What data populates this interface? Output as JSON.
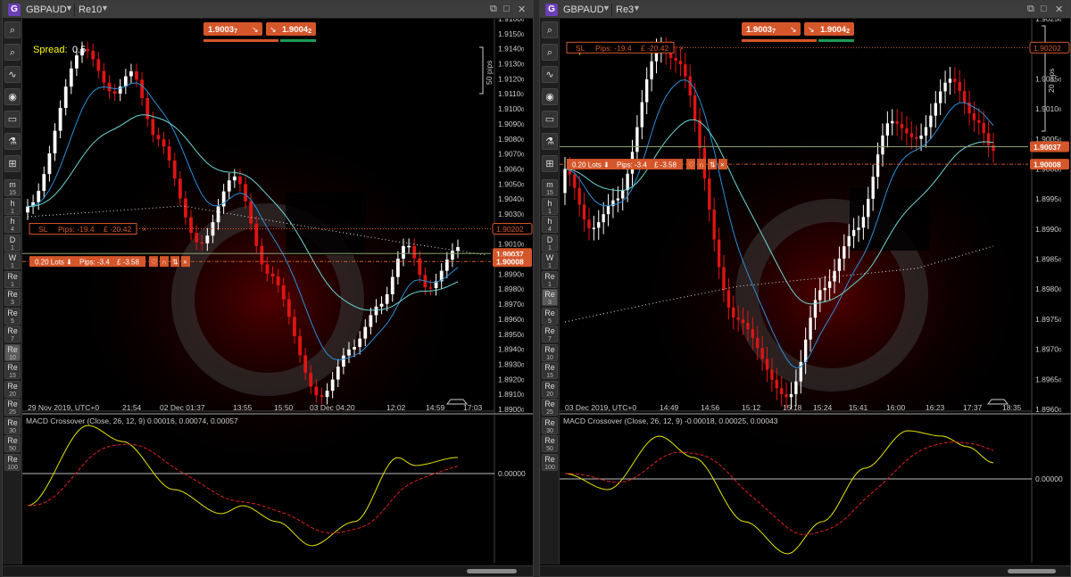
{
  "colors": {
    "bull": "#ffffff",
    "bear": "#e01414",
    "ma_fast": "#2a8fd6",
    "ma_slow": "#6fd6d6",
    "macd": "#e6e600",
    "signal": "#e02020",
    "orange": "#d4562a",
    "green": "#1f9a55"
  },
  "panels": [
    {
      "symbol": "GBPAUD",
      "timeframe": "Re10",
      "spread_label": "Spread:",
      "spread_value": "0.5",
      "bid_price": "1.9003",
      "bid_sup": "7",
      "ask_price": "1.9004",
      "ask_sup": "2",
      "scale_label": "50 pips",
      "sl_label": "SL",
      "sl_pips": "Pips: -19.4",
      "sl_pl": "£ -20.42",
      "sl_price_tag": "1.90202",
      "pos_lots": "0.20 Lots",
      "pos_pips": "Pips: -3.4",
      "pos_pl": "£ -3.58",
      "pos_price_tag": "1.90008",
      "current_price_tag": "1.90037",
      "price_axis": [
        "1.9160",
        "1.9150",
        "1.9140",
        "1.9130",
        "1.9120",
        "1.9110",
        "1.9100",
        "1.9090",
        "1.9080",
        "1.9070",
        "1.9060",
        "1.9050",
        "1.9040",
        "1.9030",
        "1.9020",
        "1.9010",
        "1.9000",
        "1.8990",
        "1.8980",
        "1.8970",
        "1.8960",
        "1.8950",
        "1.8940",
        "1.8930",
        "1.8920",
        "1.8910",
        "1.8900"
      ],
      "price_axis_digit": "0",
      "time_axis": [
        "29 Nov 2019, UTC+0",
        "21:54",
        "02 Dec 01:37",
        "13:55",
        "15:50",
        "03 Dec 04:20",
        "12:02",
        "14:59",
        "17:03"
      ],
      "macd_label": "MACD Crossover (Close, 26, 12, 9) 0.00016, 0.00074, 0.00057",
      "macd_zero": "0.00000",
      "sidebar": [
        "m15",
        "h1",
        "h4",
        "D1",
        "W1",
        "Re1",
        "Re3",
        "Re5",
        "Re7",
        "Re10",
        "Re15",
        "Re20",
        "Re25",
        "Re30",
        "Re50",
        "Re100"
      ],
      "active_tf": "Re10"
    },
    {
      "symbol": "GBPAUD",
      "timeframe": "Re3",
      "spread_label": "Spread:",
      "spread_value": "0.5",
      "bid_price": "1.9003",
      "bid_sup": "7",
      "ask_price": "1.9004",
      "ask_sup": "2",
      "scale_label": "20 pips",
      "sl_label": "SL",
      "sl_pips": "Pips: -19.4",
      "sl_pl": "£ -20.42",
      "sl_price_tag": "1.90202",
      "pos_lots": "0.20 Lots",
      "pos_pips": "Pips: -3.4",
      "pos_pl": "£ -3.58",
      "pos_price_tag": "1.90008",
      "current_price_tag": "1.90037",
      "price_axis": [
        "1.9025",
        "1.9020",
        "1.9015",
        "1.9010",
        "1.9005",
        "1.9000",
        "1.8995",
        "1.8990",
        "1.8985",
        "1.8980",
        "1.8975",
        "1.8970",
        "1.8965",
        "1.8960"
      ],
      "price_axis_digit": "0",
      "time_axis": [
        "03 Dec 2019, UTC+0",
        "14:49",
        "14:56",
        "15:12",
        "15:18",
        "15:24",
        "15:41",
        "16:00",
        "16:23",
        "17:37",
        "18:35"
      ],
      "macd_label": "MACD Crossover (Close, 26, 12, 9) -0.00018, 0.00025, 0.00043",
      "macd_zero": "0.00000",
      "sidebar": [
        "m15",
        "h1",
        "h4",
        "D1",
        "W1",
        "Re1",
        "Re3",
        "Re5",
        "Re7",
        "Re10",
        "Re15",
        "Re20",
        "Re25",
        "Re30",
        "Re50",
        "Re100"
      ],
      "active_tf": "Re3"
    }
  ]
}
